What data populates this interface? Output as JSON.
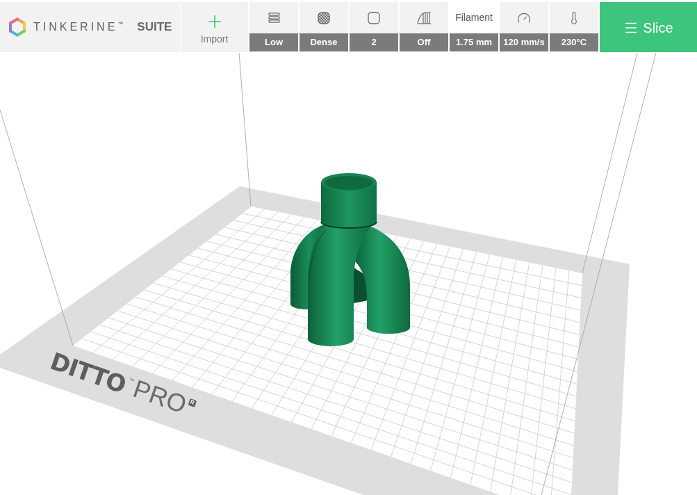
{
  "toolbar": {
    "logo": {
      "wordmark": "TINKERINE",
      "trademark": "™",
      "product": "SUITE"
    },
    "import_button": {
      "label": "Import"
    },
    "settings": [
      {
        "kind": "layers",
        "value": "Low",
        "selected": false
      },
      {
        "kind": "infill",
        "value": "Dense",
        "selected": false
      },
      {
        "kind": "shells",
        "value": "2",
        "selected": false
      },
      {
        "kind": "supports",
        "value": "Off",
        "selected": false
      },
      {
        "kind": "filament",
        "label": "Filament",
        "value": "1.75 mm",
        "selected": true
      },
      {
        "kind": "speed",
        "value": "120 mm/s",
        "selected": false
      },
      {
        "kind": "temperature",
        "value": "230°C",
        "selected": false
      }
    ],
    "slice_button": {
      "label": "Slice"
    }
  },
  "viewport": {
    "bed_label": {
      "brand": "DITTO",
      "trademark": "™",
      "model": "PRO",
      "registered": "R"
    }
  }
}
